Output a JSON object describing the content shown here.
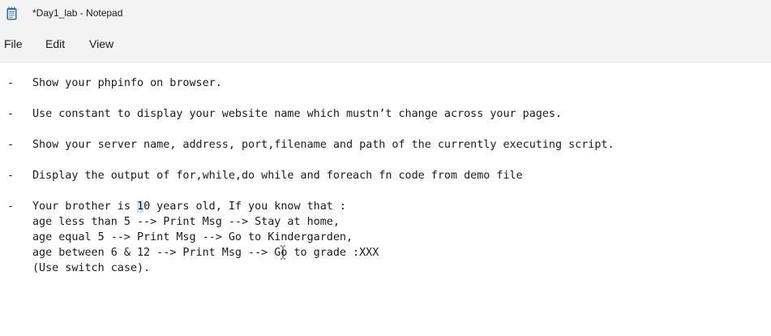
{
  "window": {
    "title": "*Day1_lab - Notepad",
    "app_icon": "notepad-icon"
  },
  "menu": {
    "file": "File",
    "edit": "Edit",
    "view": "View"
  },
  "document": {
    "bullet_char": "-",
    "items": [
      {
        "text": "Show your phpinfo on browser."
      },
      {
        "text": "Use constant to display your website name which mustn’t change across your pages."
      },
      {
        "text": "Show your server name, address, port,filename and path of the currently executing script."
      },
      {
        "text": "Display the output of for,while,do while and foreach fn code from demo file"
      }
    ],
    "last_item": {
      "line1_prefix": "Your brother is ",
      "line1_selected": "1",
      "line1_suffix": "0 years old, If you know that :",
      "line2": "age less than 5 --> Print Msg --> Stay at home,",
      "line3": "age equal 5 --> Print Msg --> Go to Kindergarden,",
      "line4_a": "age between 6 & 12 --> Print Msg --> ",
      "line4_b": "Go to grade :XXX",
      "line5": "(Use switch case)."
    }
  },
  "colors": {
    "chrome_bg": "#f3f3f3",
    "editor_bg": "#ffffff",
    "selection": "#cde3f7",
    "icon_blue": "#2b6cd3"
  }
}
